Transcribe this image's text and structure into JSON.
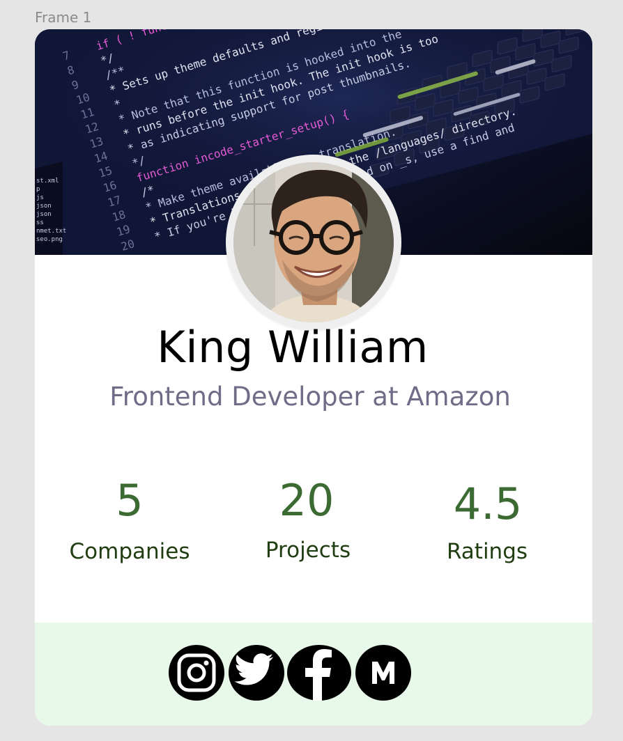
{
  "frame": {
    "label": "Frame 1"
  },
  "profile": {
    "name": "King William",
    "role": "Frontend Developer at Amazon"
  },
  "stats": [
    {
      "value": "5",
      "label": "Companies"
    },
    {
      "value": "20",
      "label": "Projects"
    },
    {
      "value": "4.5",
      "label": "Ratings"
    }
  ],
  "cover": {
    "code_lines": [
      "if ( ! function_exists",
      "*/",
      "/**",
      " * Sets up theme defaults and registers",
      " *",
      " * Note that this function is hooked into the",
      " * runs before the init hook. The init hook is too",
      " * as indicating support for post thumbnails.",
      " */",
      "function incode_starter_setup() {",
      "  /*",
      "   * Make theme available for translation.",
      "   * Translations can be filed in the /languages/ directory.",
      "   * If you're building a theme based on _s, use a find and"
    ],
    "line_numbers": [
      "7",
      "8",
      "9",
      "10",
      "11",
      "12",
      "13",
      "14",
      "15",
      "16",
      "17",
      "18",
      "19",
      "20"
    ],
    "sidebar_files": [
      "st.xml",
      "p",
      "js",
      "json",
      "json",
      "ss",
      "nmet.txt",
      "seo.png"
    ]
  },
  "social": [
    {
      "name": "instagram-icon"
    },
    {
      "name": "twitter-icon"
    },
    {
      "name": "facebook-icon"
    },
    {
      "name": "medium-icon"
    }
  ],
  "colors": {
    "stat_value": "#3c6a33",
    "stat_label": "#213d12",
    "role_text": "#6e6c87",
    "footer_bg": "#e8f8e9"
  }
}
